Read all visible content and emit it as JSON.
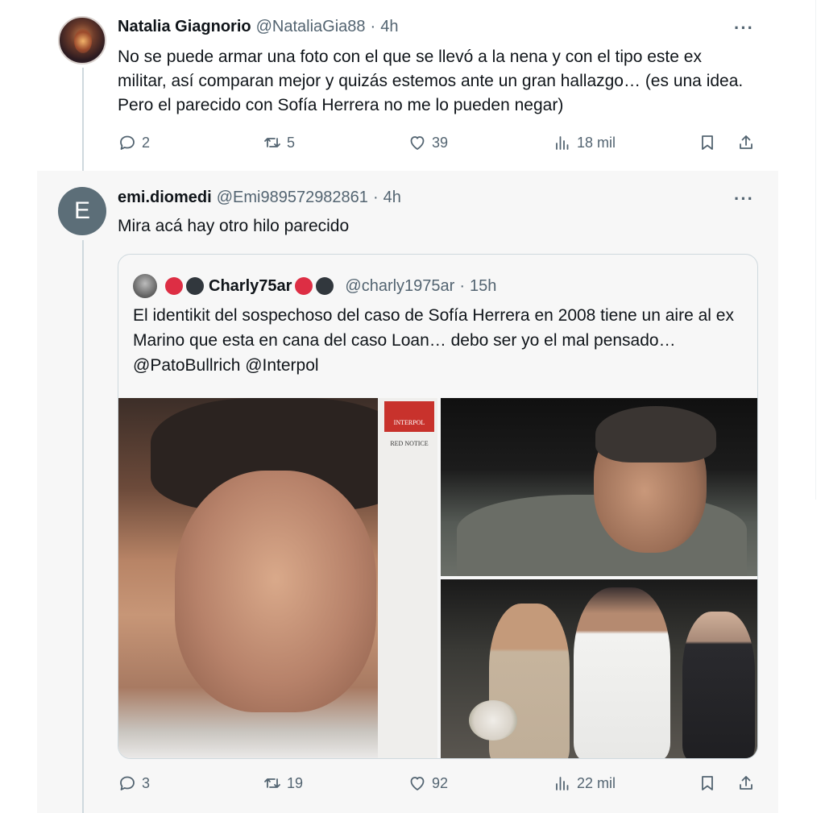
{
  "tweets": [
    {
      "name": "Natalia Giagnorio",
      "handle": "@NataliaGia88",
      "separator": "·",
      "time": "4h",
      "text": "No se puede armar una foto con el que se llevó a la nena y con el tipo este ex militar, así comparan mejor y quizás estemos ante un gran hallazgo… (es una idea. Pero el parecido con Sofía Herrera no me lo pueden negar)",
      "replies": "2",
      "retweets": "5",
      "likes": "39",
      "views": "18 mil",
      "more": "···"
    },
    {
      "name": "emi.diomedi",
      "handle": "@Emi989572982861",
      "separator": "·",
      "time": "4h",
      "avatar_letter": "E",
      "text": "Mira acá hay otro hilo parecido",
      "replies": "3",
      "retweets": "19",
      "likes": "92",
      "views": "22 mil",
      "more": "···"
    }
  ],
  "quote": {
    "name": "Charly75ar",
    "handle": "@charly1975ar",
    "separator": "·",
    "time": "15h",
    "text": "El identikit del sospechoso del caso de Sofía Herrera en 2008 tiene un aire al ex Marino que esta en cana del caso Loan… debo ser yo el mal pensado…@PatoBullrich @Interpol",
    "image_badge": "INTERPOL",
    "image_notice": "RED NOTICE"
  },
  "colors": {
    "text": "#0f1419",
    "secondary": "#536471",
    "border": "#cfd9de",
    "emoji_red": "#dd2e44",
    "emoji_black": "#31373d"
  },
  "icons": [
    "reply-icon",
    "retweet-icon",
    "like-icon",
    "views-icon",
    "bookmark-icon",
    "share-icon",
    "more-icon"
  ]
}
